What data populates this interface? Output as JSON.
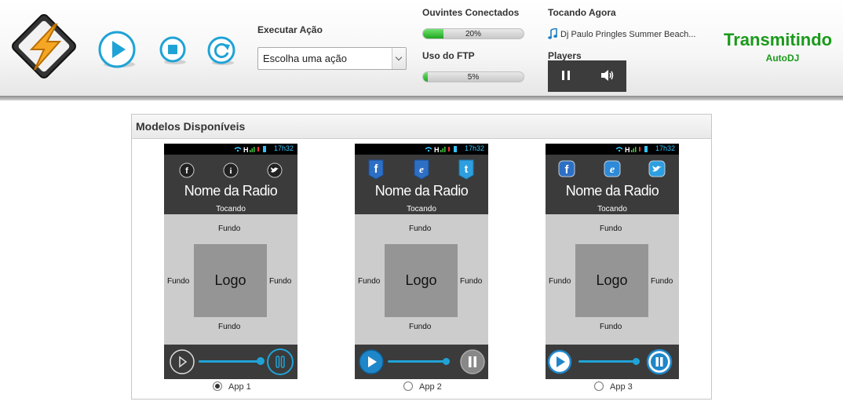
{
  "toolbar": {
    "execute_label": "Executar Ação",
    "action_select_value": "Escolha uma ação"
  },
  "stats": {
    "listeners_label": "Ouvintes Conectados",
    "listeners_percent_text": "20%",
    "listeners_percent": 20,
    "ftp_label": "Uso do FTP",
    "ftp_percent_text": "5%",
    "ftp_percent": 5
  },
  "now_playing": {
    "label": "Tocando Agora",
    "track": "Dj Paulo Pringles Summer Beach..."
  },
  "players": {
    "label": "Players"
  },
  "status": {
    "main": "Transmitindo",
    "sub": "AutoDJ"
  },
  "panel": {
    "title": "Modelos Disponíveis"
  },
  "phone_common": {
    "time": "17h32",
    "network": "H",
    "radio_name": "Nome da Radio",
    "tocando": "Tocando",
    "fundo": "Fundo",
    "logo": "Logo"
  },
  "apps": [
    {
      "label": "App 1",
      "selected": true
    },
    {
      "label": "App 2",
      "selected": false
    },
    {
      "label": "App 3",
      "selected": false
    }
  ],
  "colors": {
    "accent_blue": "#1fa3d6",
    "status_green": "#1a9a1a",
    "progress_green": "#2eb82e",
    "phone_dark": "#3b3b3b",
    "phone_light": "#cccccc"
  },
  "icons": [
    "winamp-logo-icon",
    "play-icon",
    "stop-icon",
    "reload-icon",
    "music-note-icon",
    "pause-icon",
    "volume-icon",
    "facebook-icon",
    "info-icon",
    "internet-explorer-icon",
    "twitter-icon"
  ]
}
